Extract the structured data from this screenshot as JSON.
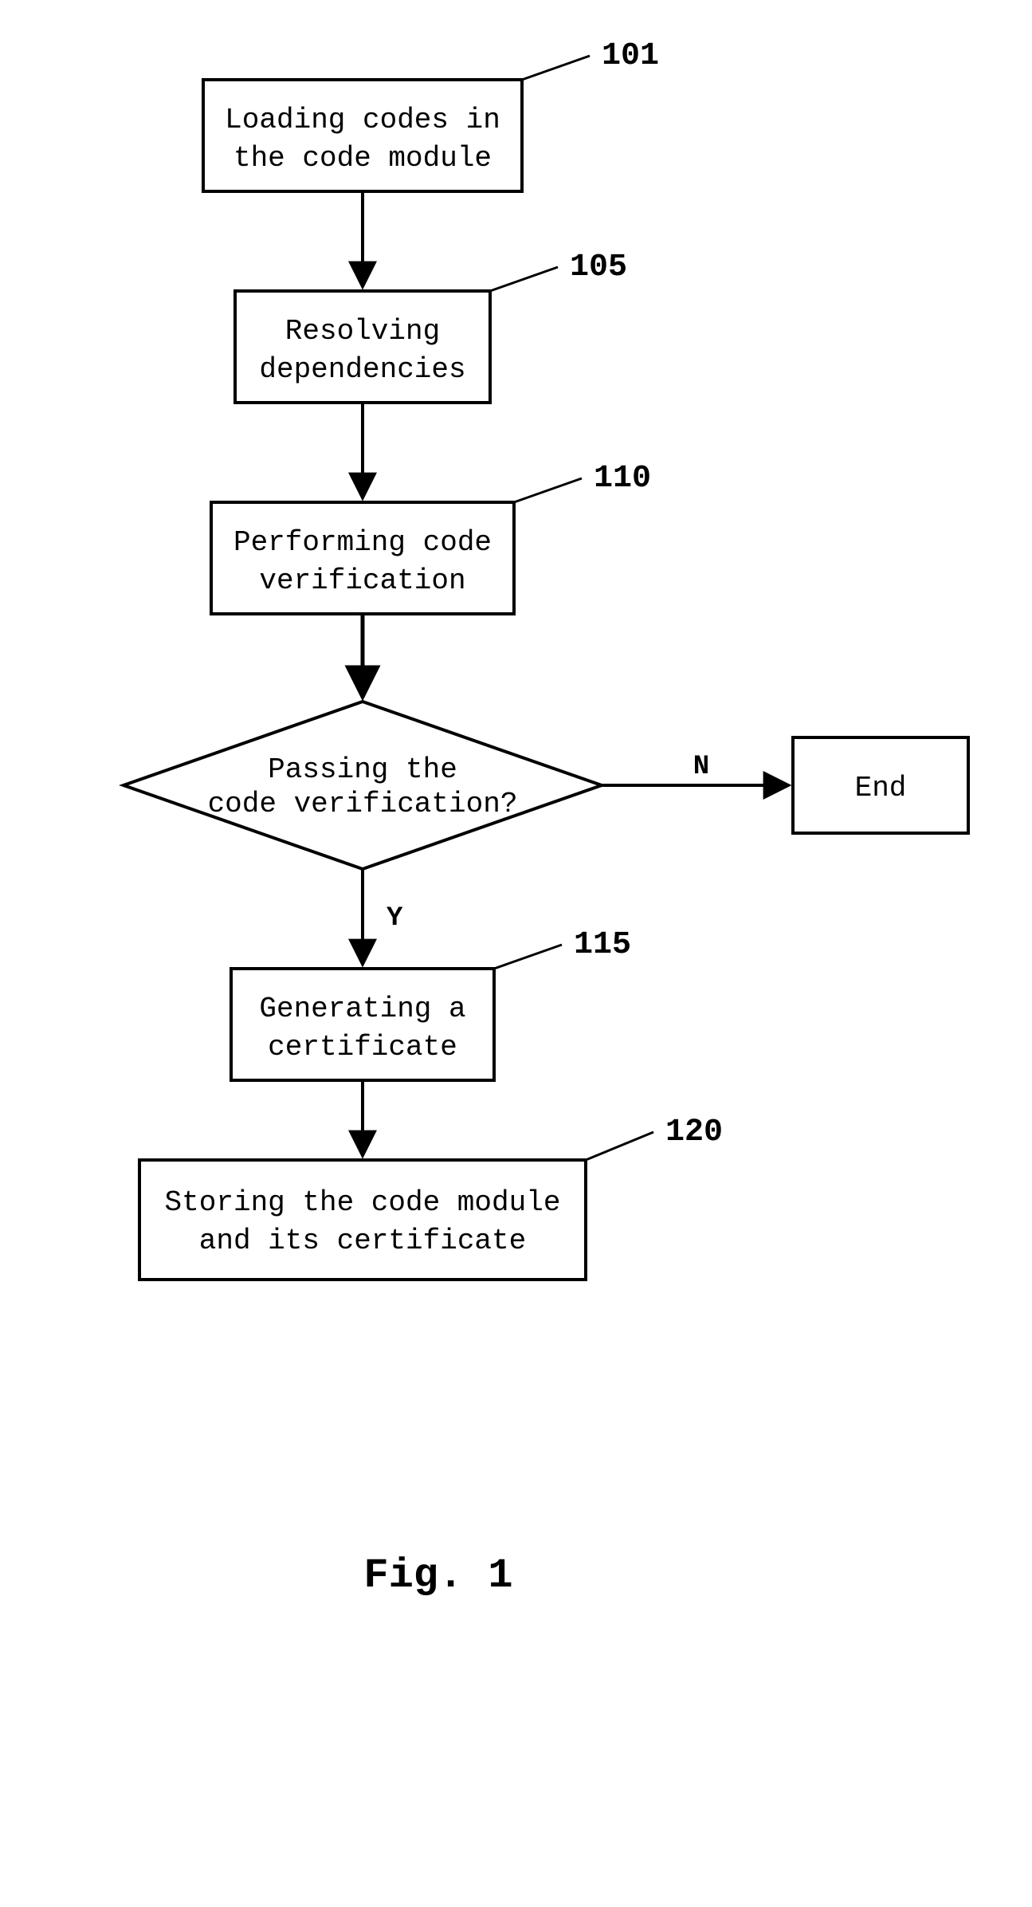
{
  "chart_data": {
    "type": "flowchart",
    "title": "Fig. 1",
    "nodes": [
      {
        "id": "101",
        "type": "process",
        "label": "Loading codes in the code module",
        "ref": "101"
      },
      {
        "id": "105",
        "type": "process",
        "label": "Resolving dependencies",
        "ref": "105"
      },
      {
        "id": "110",
        "type": "process",
        "label": "Performing code verification",
        "ref": "110"
      },
      {
        "id": "dec",
        "type": "decision",
        "label": "Passing the code verification?"
      },
      {
        "id": "115",
        "type": "process",
        "label": "Generating a certificate",
        "ref": "115"
      },
      {
        "id": "120",
        "type": "process",
        "label": "Storing the code module and its certificate",
        "ref": "120"
      },
      {
        "id": "end",
        "type": "terminator",
        "label": "End"
      }
    ],
    "edges": [
      {
        "from": "101",
        "to": "105",
        "label": ""
      },
      {
        "from": "105",
        "to": "110",
        "label": ""
      },
      {
        "from": "110",
        "to": "dec",
        "label": ""
      },
      {
        "from": "dec",
        "to": "115",
        "label": "Y"
      },
      {
        "from": "dec",
        "to": "end",
        "label": "N"
      },
      {
        "from": "115",
        "to": "120",
        "label": ""
      }
    ]
  },
  "refs": {
    "n101": "101",
    "n105": "105",
    "n110": "110",
    "n115": "115",
    "n120": "120"
  },
  "labels": {
    "n101_l1": "Loading codes in",
    "n101_l2": "the code module",
    "n105_l1": "Resolving",
    "n105_l2": "dependencies",
    "n110_l1": "Performing code",
    "n110_l2": "verification",
    "dec_l1": "Passing the",
    "dec_l2": "code verification?",
    "n115_l1": "Generating a",
    "n115_l2": "certificate",
    "n120_l1": "Storing the code module",
    "n120_l2": "and its certificate",
    "end": "End",
    "Y": "Y",
    "N": "N",
    "fig": "Fig.  1"
  }
}
